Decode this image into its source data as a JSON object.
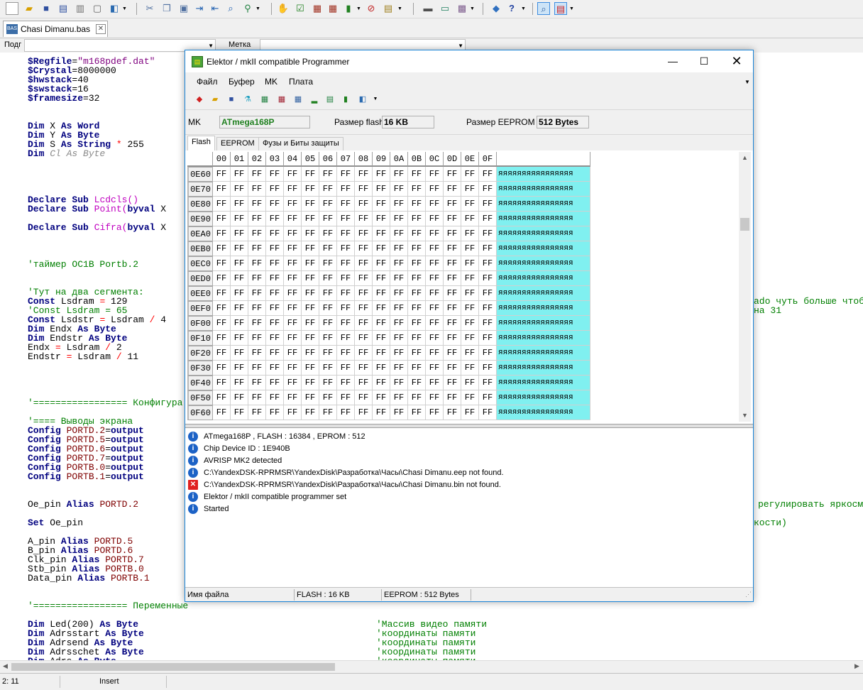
{
  "ide": {
    "doc_tab": "Chasi Dimanu.bas",
    "doc_tab_icon": "BAS",
    "combo_left_label": "Подг",
    "combo_right_label": "Метка",
    "status": {
      "position": "2: 11",
      "mode": "Insert"
    }
  },
  "code": {
    "regfile_kw": "$Regfile",
    "regfile_val": "\"m168pdef.dat\"",
    "crystal_kw": "$Crystal",
    "crystal_val": "8000000",
    "hwstack_kw": "$hwstack",
    "hwstack_val": "40",
    "swstack_kw": "$swstack",
    "swstack_val": "16",
    "framesize_kw": "$framesize",
    "framesize_val": "32",
    "dim_x": [
      "Dim",
      " X ",
      "As",
      " ",
      "Word"
    ],
    "dim_y": [
      "Dim",
      " Y ",
      "As",
      " ",
      "Byte"
    ],
    "dim_s": [
      "Dim",
      " S ",
      "As",
      " ",
      "String",
      " ",
      "*",
      " 255"
    ],
    "dim_cl": [
      "Dim",
      " ",
      "Cl As Byte"
    ],
    "decl_lcdcls": [
      "Declare",
      " ",
      "Sub",
      " ",
      "Lcdcls()"
    ],
    "decl_point": [
      "Declare",
      " ",
      "Sub",
      " ",
      "Point(",
      "byval",
      " X"
    ],
    "decl_cifra": [
      "Declare",
      " ",
      "Sub",
      " ",
      "Cifra(",
      "byval",
      " X"
    ],
    "cmt_timer": "'таймер OC1B Portb.2",
    "cmt_segments": "'Тут на два сегмента:",
    "const_lsdram": [
      "Const",
      " Lsdram ",
      "=",
      " 129"
    ],
    "cmt_const": "'Const Lsdram = 65",
    "const_lsdstr": [
      "Const",
      " Lsdstr ",
      "=",
      " Lsdram ",
      "/",
      " 4"
    ],
    "dim_endx": [
      "Dim",
      " Endx ",
      "As",
      " ",
      "Byte"
    ],
    "dim_endstr": [
      "Dim",
      " Endstr ",
      "As",
      " ",
      "Byte"
    ],
    "endx": [
      "Endx ",
      "=",
      " Lsdram ",
      "/",
      " 2"
    ],
    "endstr": [
      "Endstr ",
      "=",
      " Lsdram ",
      "/",
      " 11"
    ],
    "cmt_config": "'================= Конфигура",
    "cmt_pins": "'==== Выводы экрана",
    "config_lines": [
      [
        "Config",
        " ",
        "PORTD.2",
        "=",
        "output"
      ],
      [
        "Config",
        " ",
        "PORTD.5",
        "=",
        "output"
      ],
      [
        "Config",
        " ",
        "PORTD.6",
        "=",
        "output"
      ],
      [
        "Config",
        " ",
        "PORTD.7",
        "=",
        "output"
      ],
      [
        "Config",
        " ",
        "PORTB.0",
        "=",
        "output"
      ],
      [
        "Config",
        " ",
        "PORTB.1",
        "=",
        "output"
      ]
    ],
    "oe_alias": [
      "Oe_pin ",
      "Alias",
      " ",
      "PORTD.2"
    ],
    "set_oe": [
      "Set",
      " Oe_pin"
    ],
    "alias_lines": [
      [
        "A_pin ",
        "Alias",
        " ",
        "PORTD.5"
      ],
      [
        "B_pin ",
        "Alias",
        " ",
        "PORTD.6"
      ],
      [
        "Clk_pin ",
        "Alias",
        " ",
        "PORTD.7"
      ],
      [
        "Stb_pin ",
        "Alias",
        " ",
        "PORTB.0"
      ],
      [
        "Data_pin ",
        "Alias",
        " ",
        "PORTB.1"
      ]
    ],
    "cmt_vars": "'================= Переменные",
    "dim_vars": [
      {
        "parts": [
          "Dim",
          " Led(200) ",
          "As",
          " ",
          "Byte"
        ],
        "comment": "'Массив видео памяти"
      },
      {
        "parts": [
          "Dim",
          " Adrsstart ",
          "As",
          " ",
          "Byte"
        ],
        "comment": "'координаты памяти"
      },
      {
        "parts": [
          "Dim",
          " Adrsend ",
          "As",
          " ",
          "Byte"
        ],
        "comment": "'координаты памяти"
      },
      {
        "parts": [
          "Dim",
          " Adrsschet ",
          "As",
          " ",
          "Byte"
        ],
        "comment": "'координаты памяти"
      },
      {
        "parts": [
          "Dim",
          " Adrs ",
          "As",
          " ",
          "Byte"
        ],
        "comment": "'координаты памяти"
      }
    ],
    "right_cmt_1": "ado чуть больше чтоб",
    "right_cmt_2": "на 31",
    "right_cmt_3": "регулировать яркосм",
    "right_cmt_4": "кости)"
  },
  "programmer": {
    "title": "Elektor / mkII compatible Programmer",
    "menu": [
      "Файл",
      "Буфер",
      "MK",
      "Плата"
    ],
    "mk_label": "MK",
    "mk_value": "ATmega168P",
    "flash_label": "Размер flash",
    "flash_value": "16 KB",
    "eeprom_label": "Размер EEPROM",
    "eeprom_value": "512 Bytes",
    "tabs": [
      "Flash",
      "EEPROM",
      "Фузы и Биты защиты"
    ],
    "hex": {
      "columns": [
        "00",
        "01",
        "02",
        "03",
        "04",
        "05",
        "06",
        "07",
        "08",
        "09",
        "0A",
        "0B",
        "0C",
        "0D",
        "0E",
        "0F"
      ],
      "rows": [
        "0E60",
        "0E70",
        "0E80",
        "0E90",
        "0EA0",
        "0EB0",
        "0EC0",
        "0ED0",
        "0EE0",
        "0EF0",
        "0F00",
        "0F10",
        "0F20",
        "0F30",
        "0F40",
        "0F50",
        "0F60"
      ],
      "cell_value": "FF",
      "ascii": "яяяяяяяяяяяяяяяя"
    },
    "log": [
      {
        "type": "info",
        "text": "ATmega168P , FLASH : 16384 , EPROM : 512"
      },
      {
        "type": "info",
        "text": "Chip Device ID : 1E940B"
      },
      {
        "type": "info",
        "text": "AVRISP MK2 detected"
      },
      {
        "type": "info",
        "text": "C:\\YandexDSK-RPRMSR\\YandexDisk\\Разработка\\Часы\\Chasi Dimanu.eep not found."
      },
      {
        "type": "error",
        "text": "C:\\YandexDSK-RPRMSR\\YandexDisk\\Разработка\\Часы\\Chasi Dimanu.bin not found."
      },
      {
        "type": "info",
        "text": "Elektor / mkII compatible programmer set"
      },
      {
        "type": "info",
        "text": "Started"
      }
    ],
    "status": [
      "Имя файла",
      "FLASH : 16 KB",
      "EEPROM : 512 Bytes"
    ]
  },
  "colors": {
    "keyword": "#00007f",
    "string": "#7f007f",
    "comment": "#007f00",
    "ascii_bg": "#80f0f0",
    "info_icon": "#1c62c6",
    "error_icon": "#e02020"
  }
}
